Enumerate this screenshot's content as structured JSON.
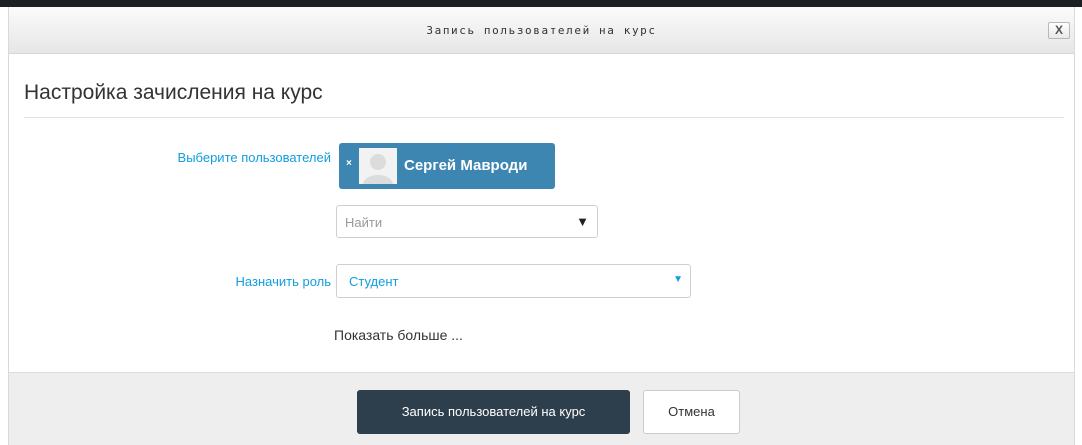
{
  "dialog": {
    "title": "Запись пользователей на курс",
    "close_label": "X"
  },
  "form": {
    "heading": "Настройка зачисления на курс",
    "users_label": "Выберите пользователей",
    "selected_user": {
      "remove_label": "×",
      "name": "Сергей Мавроди"
    },
    "search": {
      "placeholder": "Найти",
      "arrow": "▼"
    },
    "role_label": "Назначить роль",
    "role_select": {
      "value": "Студент",
      "arrow": "▼"
    },
    "show_more": "Показать больше ..."
  },
  "footer": {
    "submit_label": "Запись пользователей на курс",
    "cancel_label": "Отмена"
  },
  "colors": {
    "label_blue": "#0f9ee0",
    "chip_blue": "#3d86b2",
    "primary_button": "#2d3e4c",
    "footer_bg": "#eeeeee"
  }
}
